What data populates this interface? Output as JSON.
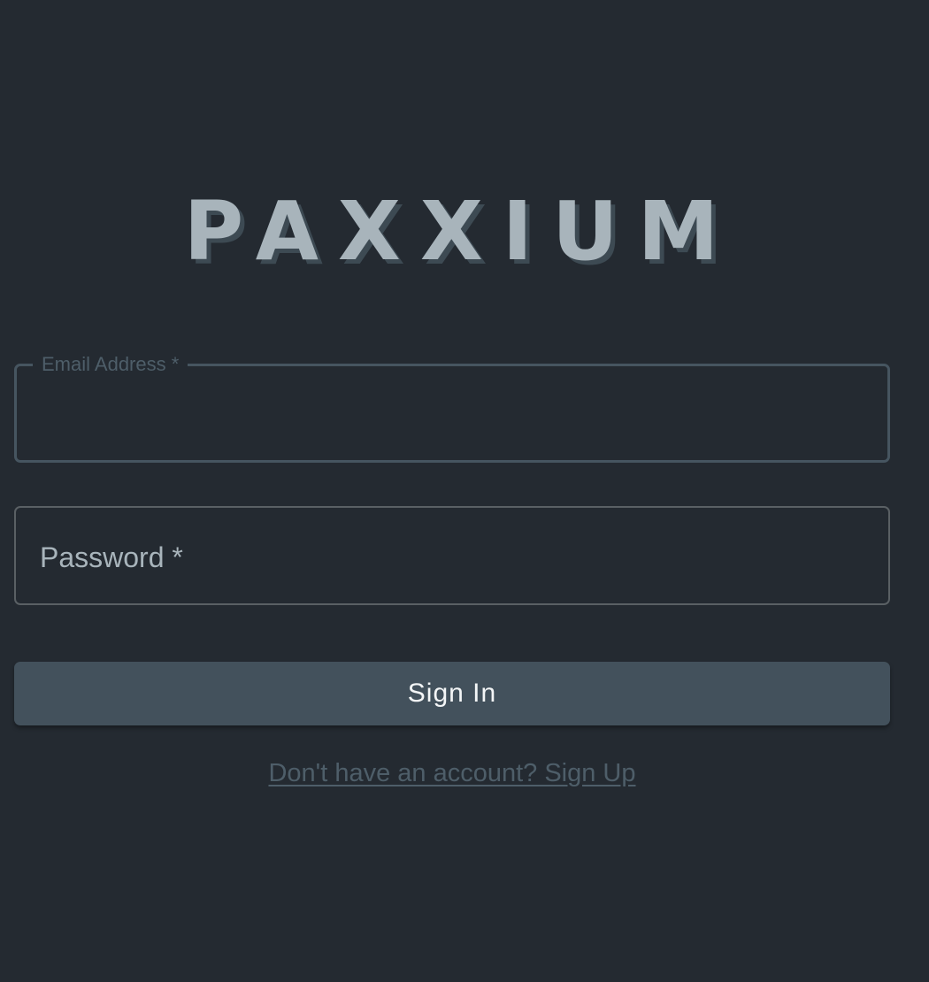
{
  "brand": {
    "logo_text": "PAXXIUM",
    "logo_color": "#a8b4bb",
    "logo_shadow_color": "#3d4a53"
  },
  "form": {
    "email": {
      "label": "Email Address *",
      "value": "",
      "placeholder": ""
    },
    "password": {
      "label": "Password *",
      "value": "",
      "placeholder": ""
    },
    "submit_label": "Sign In",
    "signup_link": "Don't have an account? Sign Up"
  },
  "colors": {
    "background": "#242a31",
    "button": "#43515c",
    "muted_text": "#4e5e69",
    "field_border_focused": "#465560",
    "field_border": "#5a6064"
  }
}
